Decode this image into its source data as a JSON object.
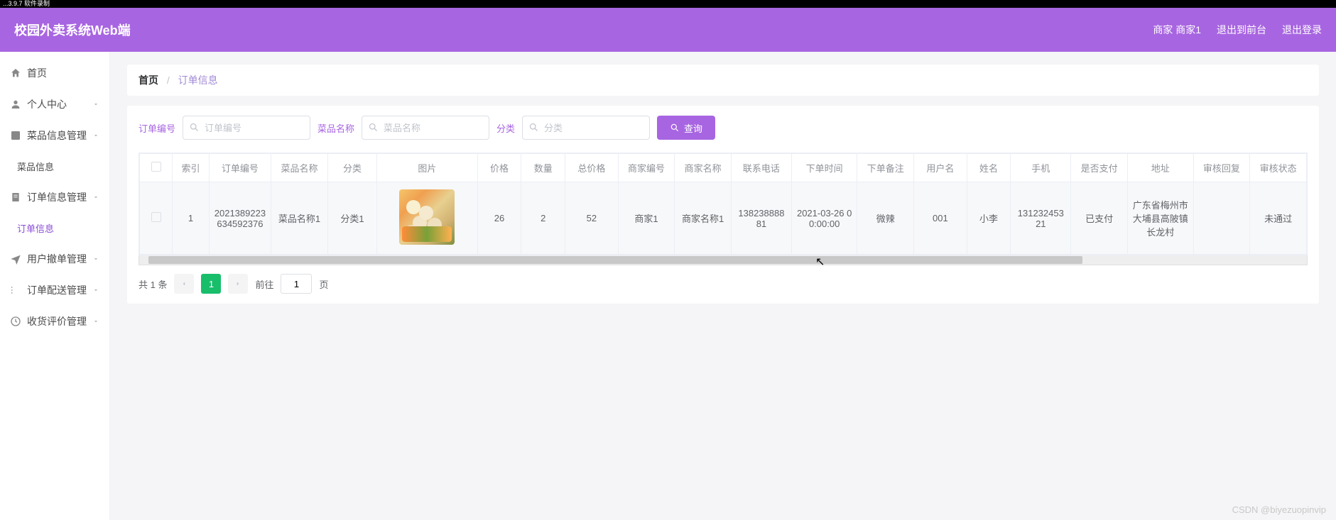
{
  "topstrip": "...3.9.7 软件录制",
  "header": {
    "title": "校园外卖系统Web端",
    "user": "商家 商家1",
    "front": "退出到前台",
    "logout": "退出登录"
  },
  "sidebar": {
    "home": "首页",
    "personal": "个人中心",
    "dish_mgmt": "菜品信息管理",
    "dish_info": "菜品信息",
    "order_mgmt": "订单信息管理",
    "order_info": "订单信息",
    "cancel_mgmt": "用户撤单管理",
    "delivery_mgmt": "订单配送管理",
    "review_mgmt": "收货评价管理"
  },
  "breadcrumb": {
    "home": "首页",
    "cur": "订单信息"
  },
  "search": {
    "l_order": "订单编号",
    "ph_order": "订单编号",
    "l_dish": "菜品名称",
    "ph_dish": "菜品名称",
    "l_cat": "分类",
    "ph_cat": "分类",
    "btn": "查询"
  },
  "columns": [
    "索引",
    "订单编号",
    "菜品名称",
    "分类",
    "图片",
    "价格",
    "数量",
    "总价格",
    "商家编号",
    "商家名称",
    "联系电话",
    "下单时间",
    "下单备注",
    "用户名",
    "姓名",
    "手机",
    "是否支付",
    "地址",
    "审核回复",
    "审核状态"
  ],
  "row": {
    "idx": "1",
    "order_no": "2021389223634592376",
    "dish": "菜品名称1",
    "cat": "分类1",
    "price": "26",
    "qty": "2",
    "total": "52",
    "merchant_no": "商家1",
    "merchant_name": "商家名称1",
    "phone": "13823888881",
    "time": "2021-03-26 00:00:00",
    "remark": "微辣",
    "username": "001",
    "name": "小李",
    "mobile": "13123245321",
    "paid": "已支付",
    "addr": "广东省梅州市大埔县高陂镇长龙村",
    "reply": "",
    "status": "未通过"
  },
  "pager": {
    "total": "共 1 条",
    "cur": "1",
    "goto_pre": "前往",
    "goto_val": "1",
    "goto_suf": "页"
  },
  "watermark": "CSDN @biyezuopinvip"
}
